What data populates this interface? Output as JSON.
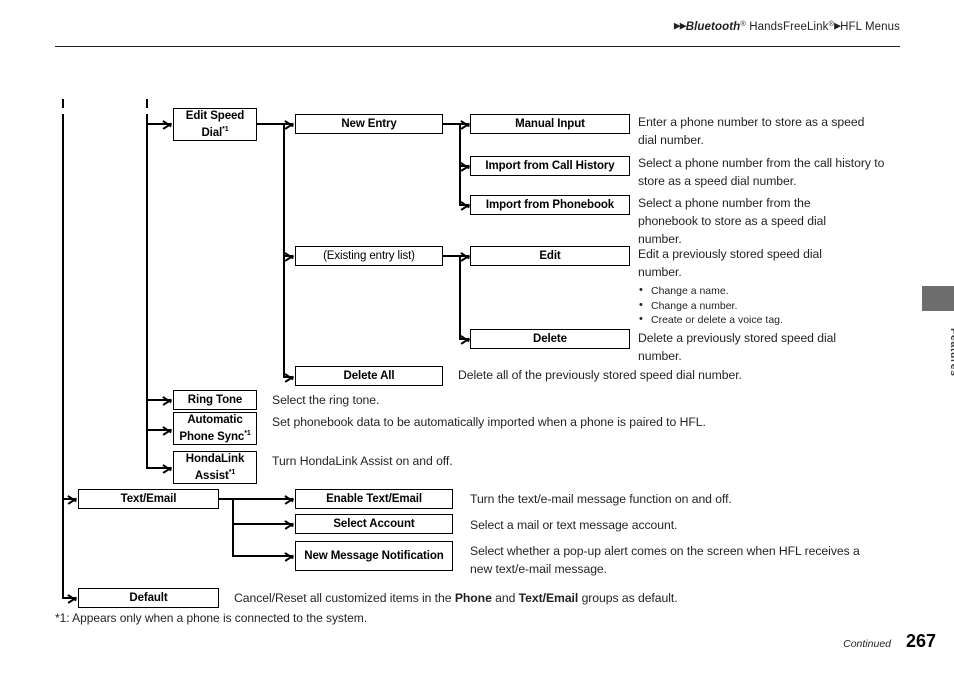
{
  "header": {
    "breadcrumb_prefix": "▶▶",
    "breadcrumb_brand": "Bluetooth",
    "breadcrumb_reg1": "®",
    "breadcrumb_product": " HandsFreeLink",
    "breadcrumb_reg2": "®",
    "breadcrumb_sep": "▶",
    "breadcrumb_section": "HFL Menus"
  },
  "side_tab": {
    "label": "Features"
  },
  "boxes": {
    "edit_speed_dial": "Edit Speed Dial",
    "edit_speed_dial_note": "*1",
    "new_entry": "New Entry",
    "manual_input": "Manual Input",
    "import_call_history": "Import from Call History",
    "import_phonebook": "Import from Phonebook",
    "existing_entry_list": "(Existing entry list)",
    "edit": "Edit",
    "delete": "Delete",
    "delete_all": "Delete All",
    "ring_tone": "Ring Tone",
    "automatic_phone_sync": "Automatic Phone Sync",
    "automatic_phone_sync_note": "*1",
    "hondalink_assist": "HondaLink Assist",
    "hondalink_assist_note": "*1",
    "text_email": "Text/Email",
    "enable_text_email": "Enable Text/Email",
    "select_account": "Select Account",
    "new_message_notification": "New Message Notification",
    "default": "Default"
  },
  "descriptions": {
    "manual_input": "Enter a phone number to store as a speed dial number.",
    "import_call_history": "Select a phone number from the call history to store as a speed dial number.",
    "import_phonebook": "Select a phone number from the phonebook to store as a speed dial number.",
    "edit": "Edit a previously stored speed dial number.",
    "edit_bullets": [
      "Change a name.",
      "Change a number.",
      "Create or delete a voice tag."
    ],
    "delete": "Delete a previously stored speed dial number.",
    "delete_all": "Delete all of the previously stored speed dial number.",
    "ring_tone": "Select the ring tone.",
    "automatic_phone_sync": "Set phonebook data to be automatically imported when a phone is paired to HFL.",
    "hondalink_assist": "Turn HondaLink Assist on and off.",
    "enable_text_email": "Turn the text/e-mail message function on and off.",
    "select_account": "Select a mail or text message account.",
    "new_message_notification": "Select whether a pop-up alert comes on the screen when HFL receives a new text/e-mail message.",
    "default_prefix": "Cancel/Reset all customized items in the ",
    "default_bold1": "Phone",
    "default_mid": " and ",
    "default_bold2": "Text/Email",
    "default_suffix": " groups as default."
  },
  "footnote": "*1: Appears only when a phone is connected to the system.",
  "footer": {
    "continued": "Continued",
    "page_number": "267"
  }
}
